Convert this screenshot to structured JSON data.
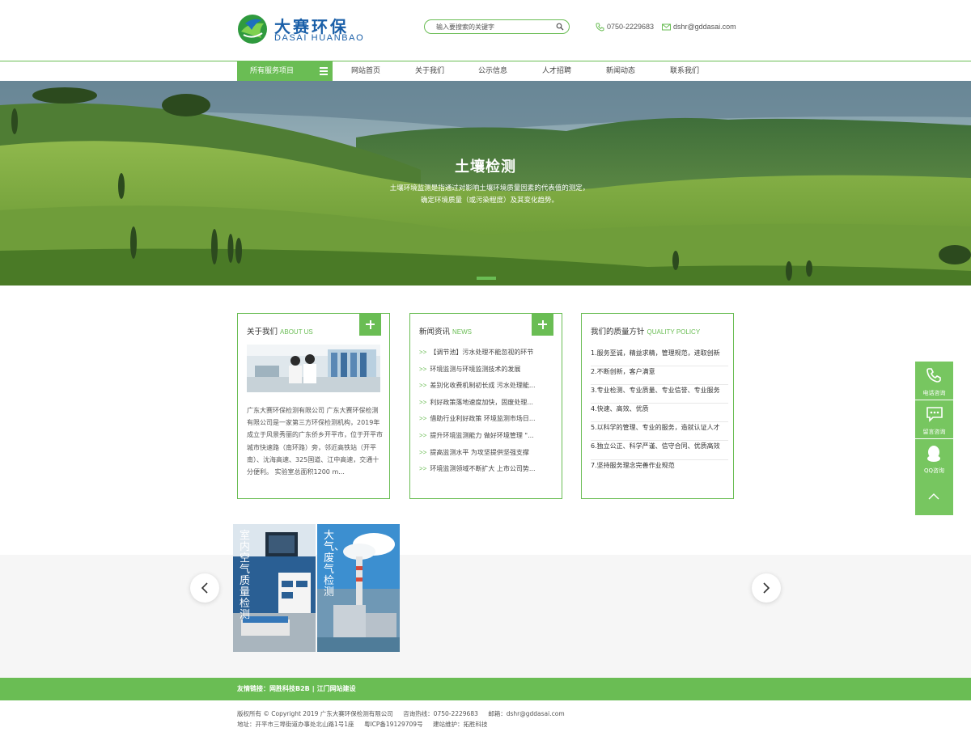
{
  "header": {
    "logo_cn": "大赛环保",
    "logo_en": "DASAI HUANBAO",
    "search_placeholder": "输入要搜索的关键字",
    "phone": "0750-2229683",
    "email": "dshr@gddasai.com"
  },
  "nav": {
    "services": "所有服务项目",
    "items": [
      "网站首页",
      "关于我们",
      "公示信息",
      "人才招聘",
      "新闻动态",
      "联系我们"
    ]
  },
  "banner": {
    "title": "土壤检测",
    "desc_line1": "土壤环境监测是指通过对影响土壤环境质量因素的代表值的测定，",
    "desc_line2": "确定环境质量（或污染程度）及其变化趋势。"
  },
  "about": {
    "title": "关于我们",
    "title_en": "ABOUT US",
    "text": "广东大赛环保检测有限公司 广东大赛环保检测有限公司是一家第三方环保检测机构，2019年成立于风景秀丽的广东侨乡开平市，位于开平市城市快速路（南环路）旁，邻近高铁站（开平南）、沈海高速、325国道、江中高速，交通十分便利。 实验室总面积1200 m..."
  },
  "news": {
    "title": "新闻资讯",
    "title_en": "NEWS",
    "arrow": ">>",
    "items": [
      "【调节池】污水处理不能忽视的环节",
      "环境监测与环境监测技术的发展",
      "差别化收费机制初长成 污水处理能...",
      "利好政策落地速度加快，固废处理...",
      "借助行业利好政策 环境监测市场日...",
      "提升环境监测能力 做好环境管理 \"...",
      "提高监测水平 为攻坚提供坚强支撑",
      "环境监测领域不断扩大 上市公司势..."
    ]
  },
  "policy": {
    "title": "我们的质量方针",
    "title_en": "QUALITY POLICY",
    "items": [
      "1.服务至诚，精益求精，管理规范，进取创新",
      "2.不断创新，客户满意",
      "3.专业检测、专业质量、专业信誉、专业服务",
      "4.快速、高效、优质",
      "5.以科学的管理、专业的服务，造就认证人才",
      "6.独立公正、科学严谨、信守合同、优质高效",
      "7.坚持服务理念完善作业规范"
    ]
  },
  "services": [
    {
      "label": "室内空气质量检测"
    },
    {
      "label": "大气、废气检测"
    }
  ],
  "side_float": {
    "phone_label": "电话咨询",
    "message_label": "留言咨询",
    "qq_label": "QQ咨询"
  },
  "footer": {
    "links_label": "友情链接：",
    "link1": "网胜科技B2B",
    "link2": "江门网站建设",
    "copyright": "版权所有 © Copyright 2019 广东大赛环保检测有限公司",
    "hotline": "咨询热线：0750-2229683",
    "mail": "邮箱：dshr@gddasai.com",
    "address": "地址：开平市三埠街道办事处北山路1号1座",
    "icp": "粤ICP备19129709号",
    "builder": "建站维护：拓胜科技"
  },
  "colors": {
    "accent": "#6abd54",
    "logo_blue": "#1a5fa8"
  }
}
